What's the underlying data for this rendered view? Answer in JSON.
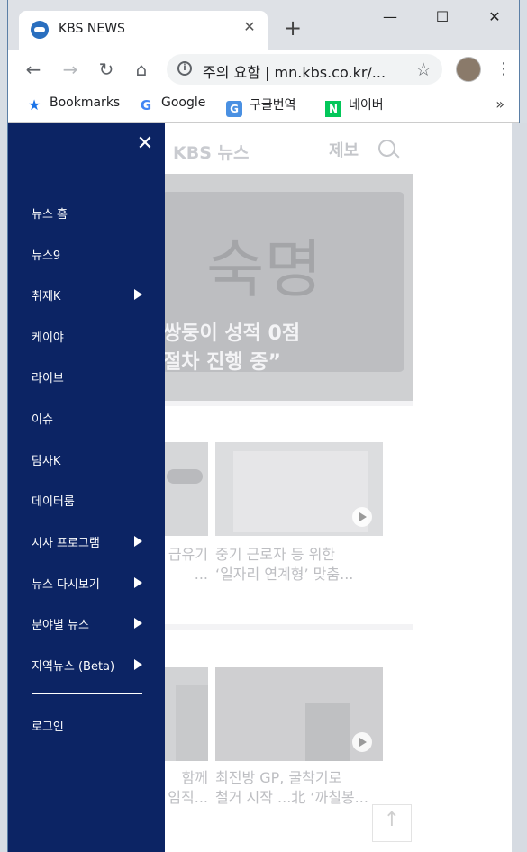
{
  "browser": {
    "tab_title": "KBS NEWS",
    "tab_close": "✕",
    "new_tab": "+",
    "window_controls": {
      "minimize": "—",
      "maximize": "☐",
      "close": "✕"
    },
    "nav": {
      "back": "←",
      "forward": "→",
      "reload": "↻",
      "home": "⌂"
    },
    "omnibox": {
      "info_icon": "i",
      "text": "주의 요함 | mn.kbs.co.kr/...",
      "star": "☆"
    },
    "menu": "⋮",
    "bookmarks": [
      {
        "icon": "★",
        "label": "Bookmarks"
      },
      {
        "icon": "G",
        "label": "Google"
      },
      {
        "icon": "G",
        "label": "구글번역"
      },
      {
        "icon": "N",
        "label": "네이버"
      }
    ],
    "bookmarks_more": "»"
  },
  "site": {
    "logo": "KBS 뉴스",
    "report": "제보",
    "hero_title_line1": "쌍둥이 성적 0점",
    "hero_title_line2": "절차 진행 중”",
    "hero_image_text": "숙명",
    "cards": [
      {
        "caption_line1": "급유기",
        "caption_line2": "..."
      },
      {
        "caption_line1": "중기 근로자 등 위한",
        "caption_line2": "‘일자리 연계형’ 맞춤..."
      },
      {
        "caption_line1": "함께",
        "caption_line2": "임직..."
      },
      {
        "caption_line1": "최전방 GP, 굴착기로",
        "caption_line2": "철거 시작 ...北 ‘까칠봉..."
      }
    ]
  },
  "drawer": {
    "close": "✕",
    "items": [
      {
        "label": "뉴스 홈",
        "has_submenu": false
      },
      {
        "label": "뉴스9",
        "has_submenu": false
      },
      {
        "label": "취재K",
        "has_submenu": true
      },
      {
        "label": "케이야",
        "has_submenu": false
      },
      {
        "label": "라이브",
        "has_submenu": false
      },
      {
        "label": "이슈",
        "has_submenu": false
      },
      {
        "label": "탐사K",
        "has_submenu": false
      },
      {
        "label": "데이터룸",
        "has_submenu": false
      },
      {
        "label": "시사 프로그램",
        "has_submenu": true
      },
      {
        "label": "뉴스 다시보기",
        "has_submenu": true
      },
      {
        "label": "분야별 뉴스",
        "has_submenu": true
      },
      {
        "label": "지역뉴스 (Beta)",
        "has_submenu": true
      }
    ],
    "login": "로그인"
  },
  "colors": {
    "drawer_bg": "#0c2464",
    "chrome_bg": "#dee1e6"
  }
}
